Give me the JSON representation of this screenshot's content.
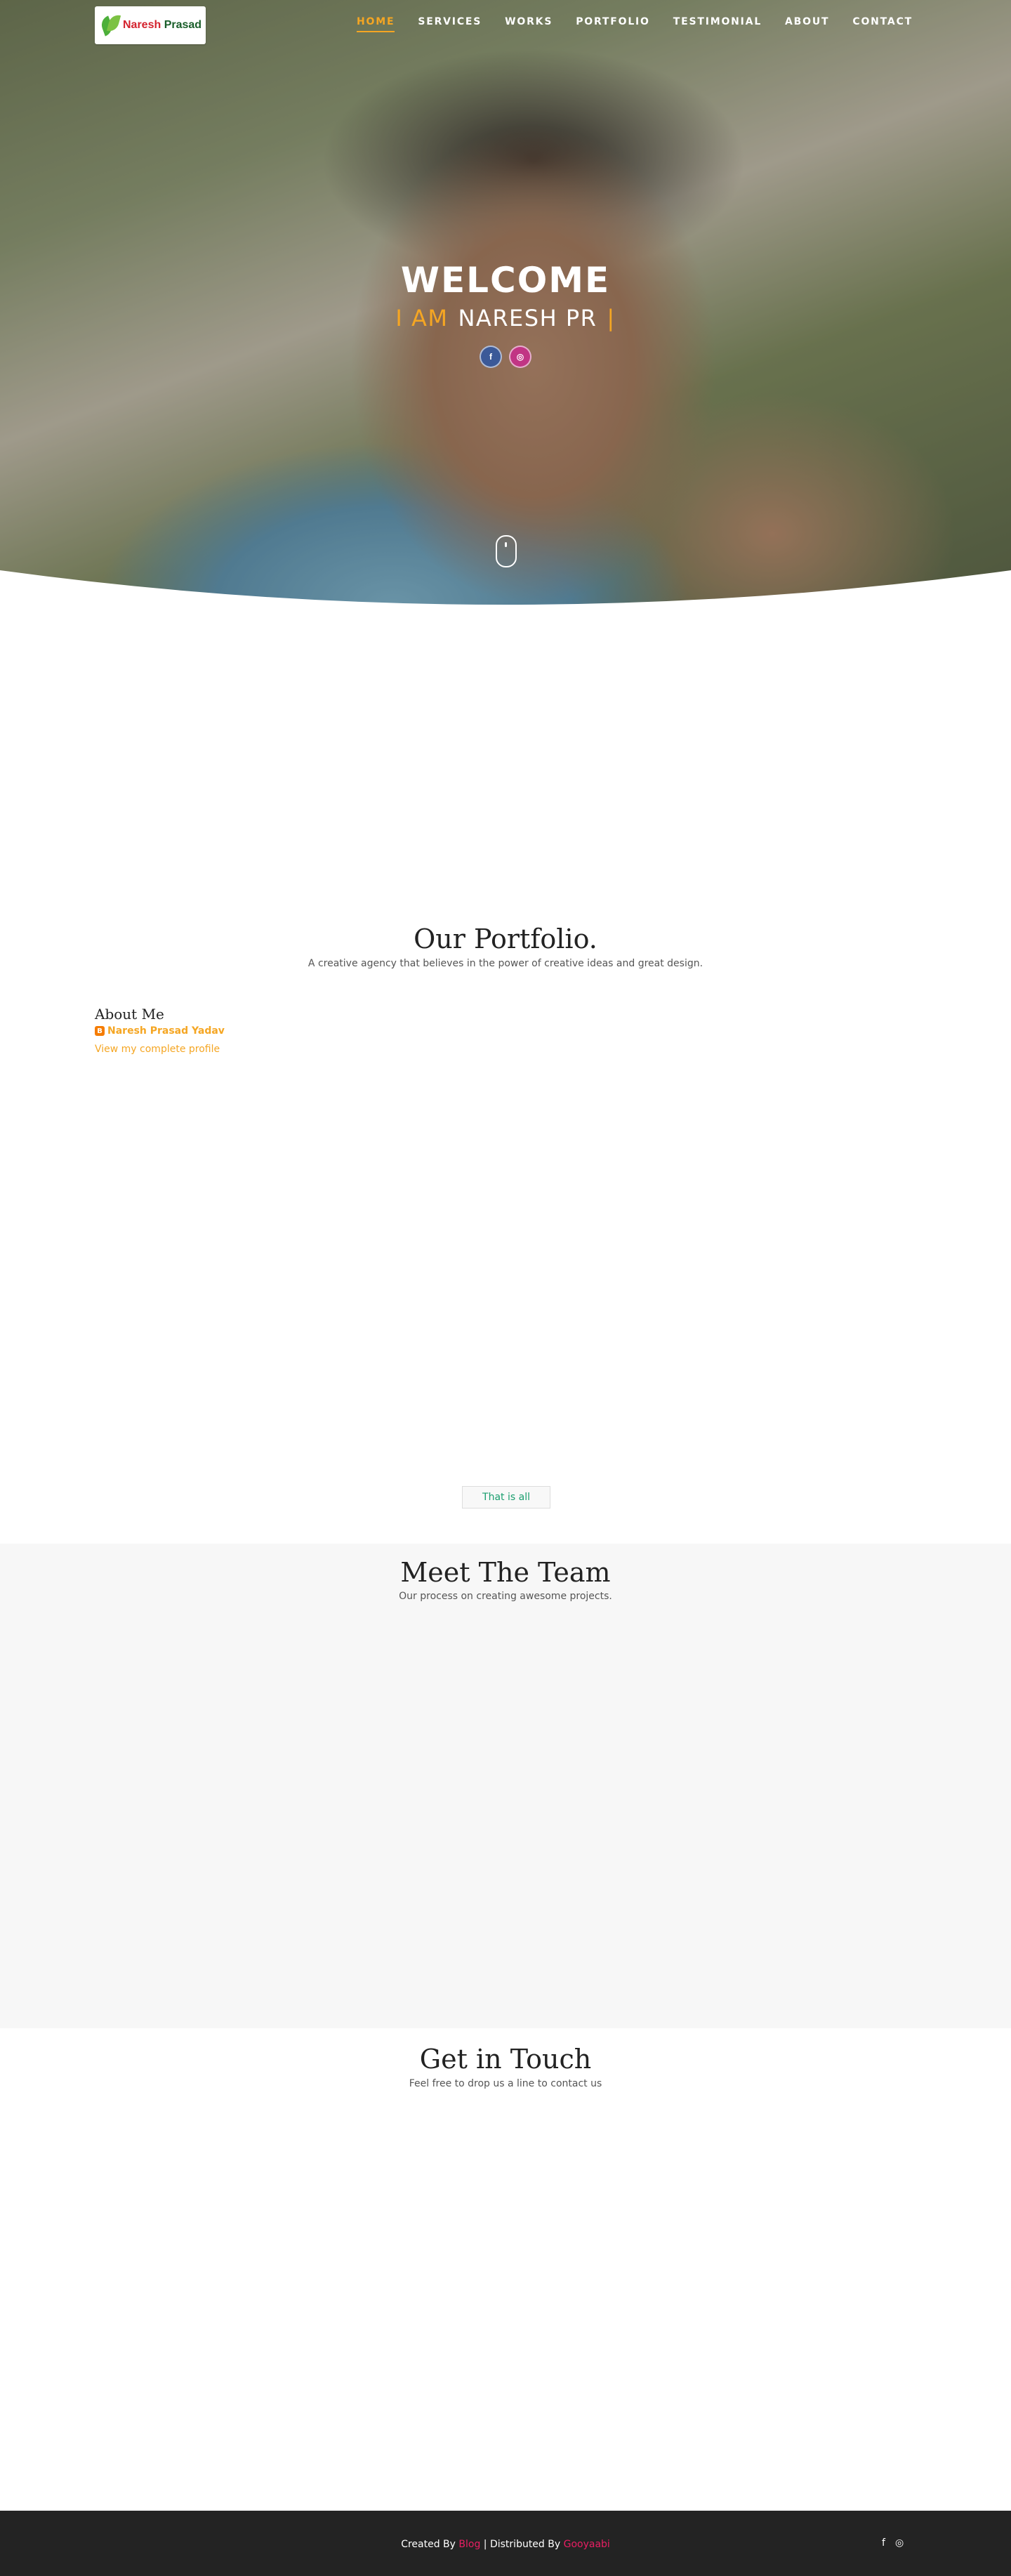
{
  "nav": {
    "logo": {
      "word1": "Naresh",
      "word2": "Prasad"
    },
    "items": [
      {
        "label": "HOME",
        "active": true
      },
      {
        "label": "SERVICES"
      },
      {
        "label": "WORKS"
      },
      {
        "label": "PORTFOLIO"
      },
      {
        "label": "TESTIMONIAL"
      },
      {
        "label": "ABOUT"
      },
      {
        "label": "CONTACT"
      }
    ],
    "accent_color": "#f5a623"
  },
  "hero": {
    "welcome": "WELCOME",
    "iam_prefix": "I AM",
    "name_typing": "NARESH PR",
    "cursor": "|",
    "socials": [
      {
        "icon": "facebook-icon",
        "glyph": "f"
      },
      {
        "icon": "instagram-icon",
        "glyph": "◎"
      }
    ]
  },
  "portfolio": {
    "title": "Our Portfolio.",
    "subtitle": "A creative agency that believes in the power of creative ideas and great design."
  },
  "about": {
    "title": "About Me",
    "name": "Naresh Prasad Yadav",
    "blogger_icon": "B",
    "profile_link": "View my complete profile"
  },
  "load_more": {
    "label": "That is all"
  },
  "team": {
    "title": "Meet The Team",
    "subtitle": "Our process on creating awesome projects."
  },
  "contact": {
    "title": "Get in Touch",
    "subtitle": "Feel free to drop us a line to contact us"
  },
  "footer": {
    "created_by": "Created By",
    "blog_link": "Blog",
    "separator": "| Distributed By",
    "distributor_link": "Gooyaabi",
    "icons": [
      {
        "icon": "facebook-icon",
        "glyph": "f"
      },
      {
        "icon": "instagram-icon",
        "glyph": "◎"
      }
    ]
  }
}
